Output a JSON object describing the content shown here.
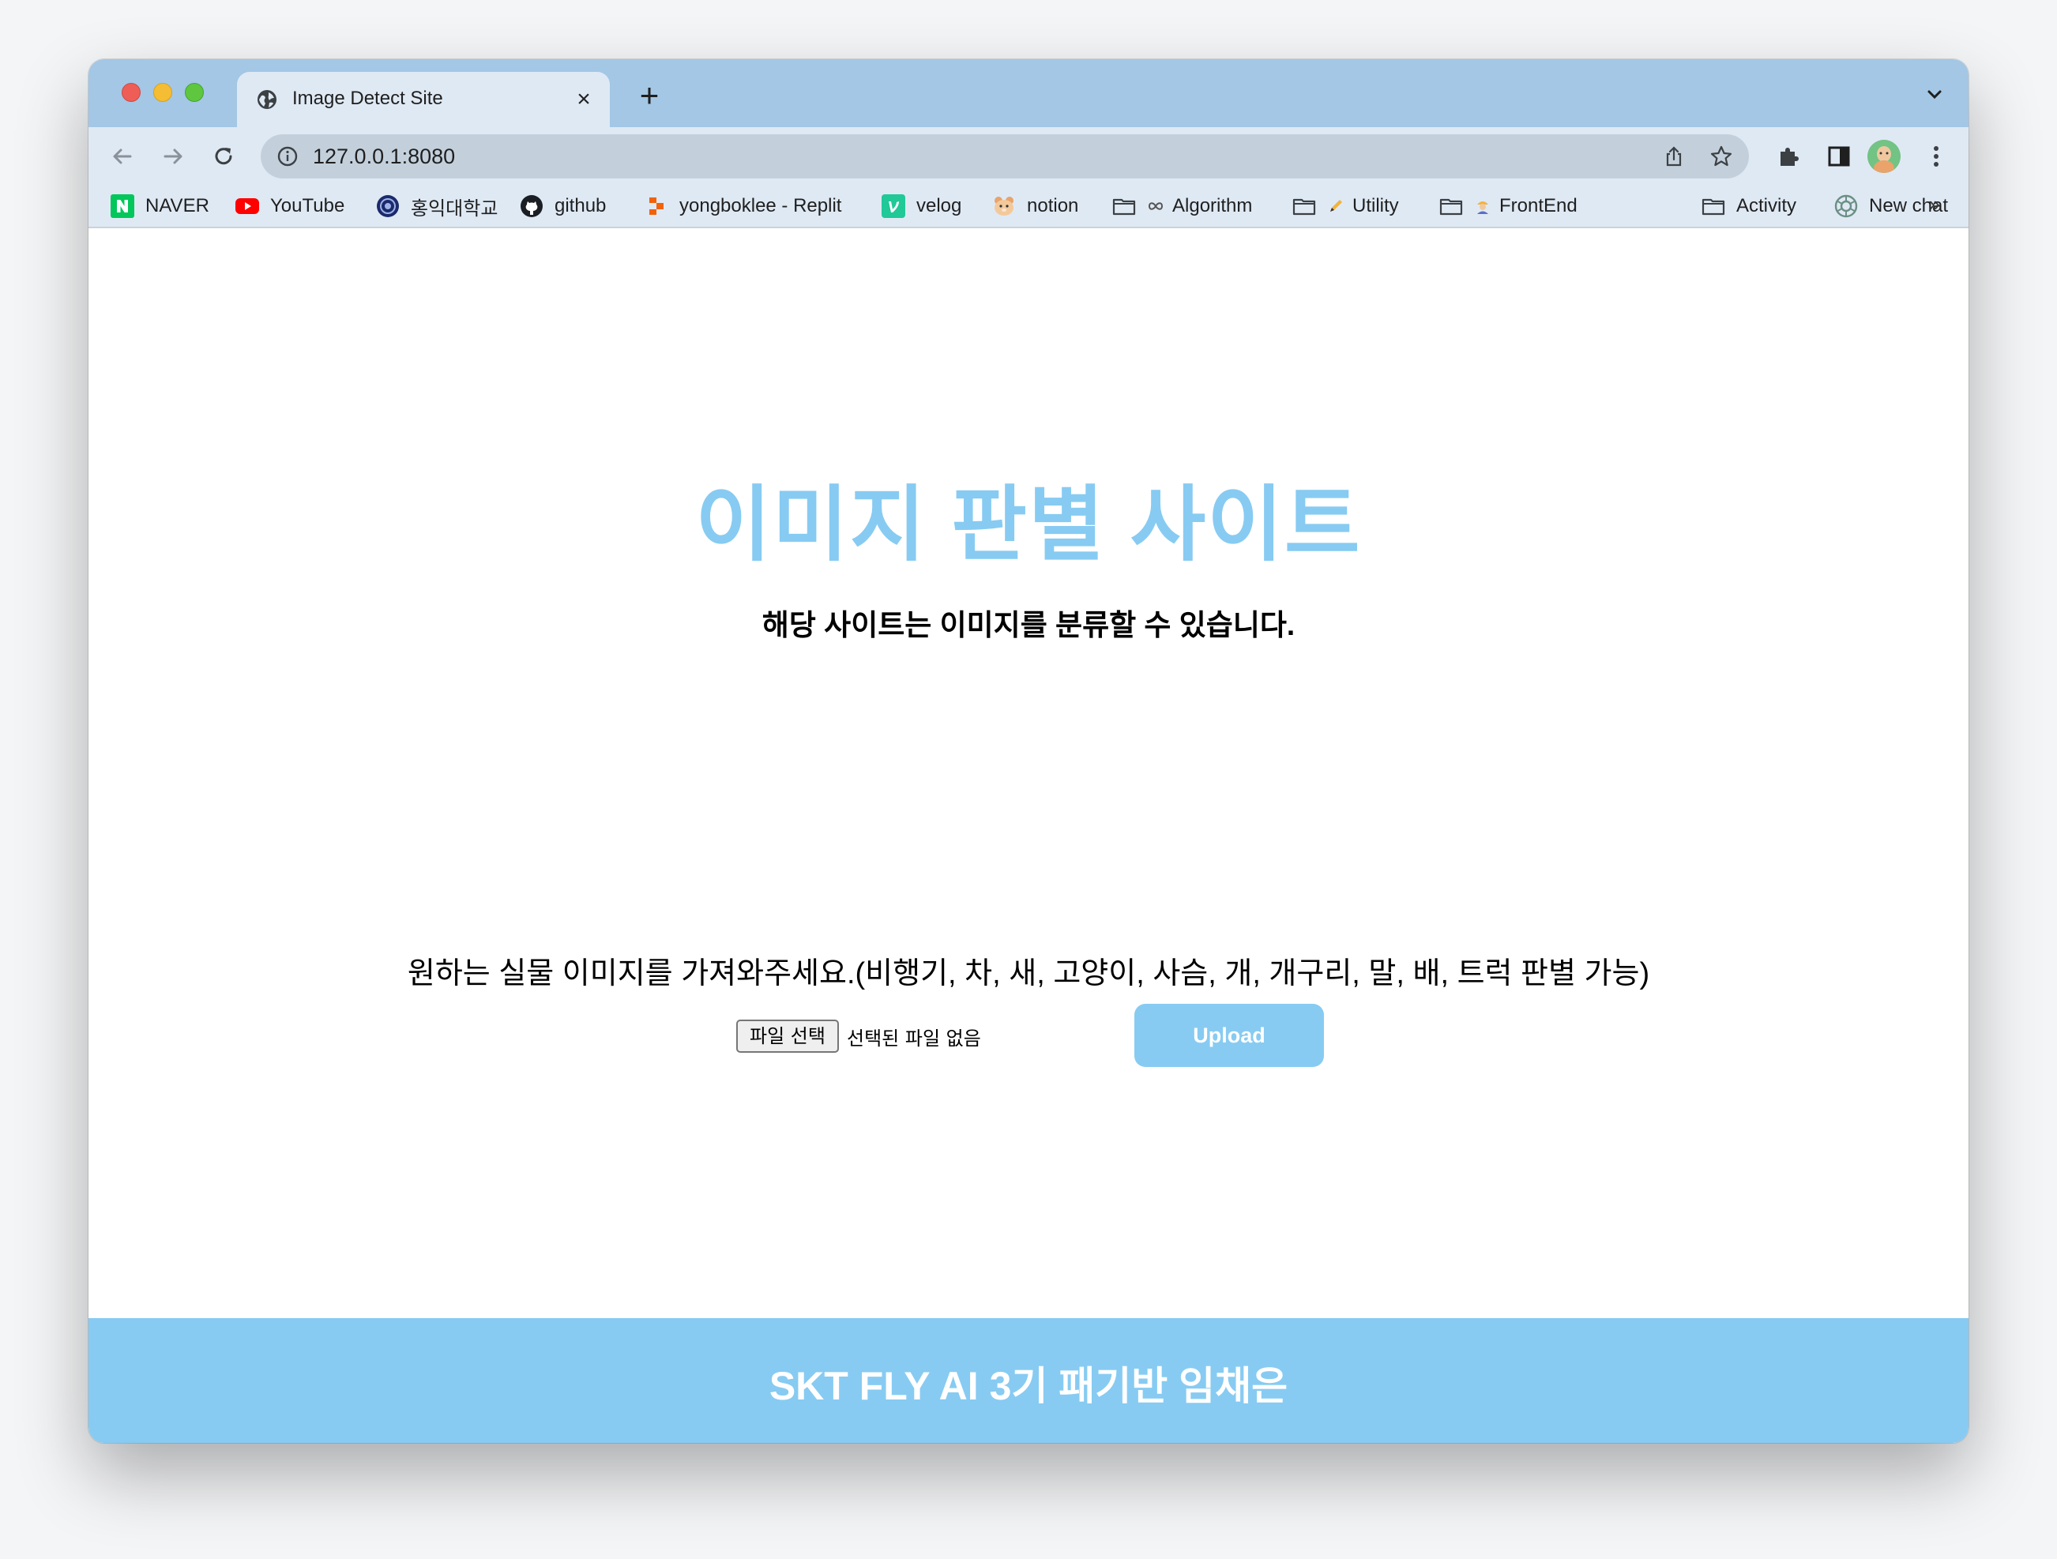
{
  "browser": {
    "tab_title": "Image Detect Site",
    "tab_close_glyph": "×",
    "new_tab_glyph": "+",
    "url": "127.0.0.1:8080",
    "bookmarks": [
      {
        "label": "NAVER",
        "icon": "naver-icon"
      },
      {
        "label": "YouTube",
        "icon": "youtube-icon"
      },
      {
        "label": "홍익대학교",
        "icon": "hongik-icon"
      },
      {
        "label": "github",
        "icon": "github-icon"
      },
      {
        "label": "yongboklee - Replit",
        "icon": "replit-icon"
      },
      {
        "label": "velog",
        "icon": "velog-icon"
      },
      {
        "label": "notion",
        "icon": "hamster-icon"
      },
      {
        "label": "Algorithm",
        "icon": "folder-icon"
      },
      {
        "label": "Utility",
        "icon": "folder-icon"
      },
      {
        "label": "FrontEnd",
        "icon": "folder-icon"
      },
      {
        "label": "Activity",
        "icon": "folder-icon"
      },
      {
        "label": "New chat",
        "icon": "chatgpt-icon"
      }
    ],
    "more_glyph": "»"
  },
  "page": {
    "title": "이미지 판별 사이트",
    "subtitle": "해당 사이트는 이미지를 분류할 수 있습니다.",
    "instruction": "원하는 실물 이미지를 가져와주세요.(비행기, 차, 새, 고양이, 사슴, 개, 개구리, 말, 배, 트럭 판별 가능)",
    "file_button_label": "파일 선택",
    "file_status": "선택된 파일 없음",
    "upload_label": "Upload",
    "footer_text": "SKT FLY AI 3기 패기반 임채은"
  },
  "colors": {
    "accent": "#87cbf2",
    "tabstrip": "#a3c7e5",
    "toolbar": "#dfe9f4"
  }
}
